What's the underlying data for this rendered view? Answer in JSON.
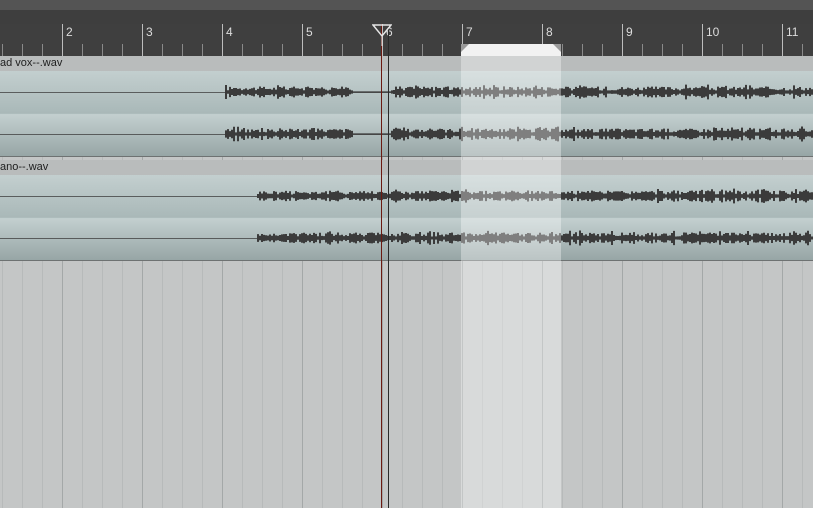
{
  "ruler": {
    "labels": [
      "2",
      "3",
      "4",
      "5",
      "6",
      "7",
      "8",
      "9",
      "10",
      "11"
    ]
  },
  "tracks": [
    {
      "item_name": "ad vox--.wav"
    },
    {
      "item_name": "ano--.wav"
    }
  ],
  "colors": {
    "ruler_bg": "#3f3f3f",
    "item_body": "#b3c2c2",
    "waveform": "#3b3b3b",
    "edit_cursor": "#6b1a12",
    "time_selection": "#e6eaea"
  },
  "icons": {
    "play_cursor": "triangle-down-icon",
    "selection_start": "triangle-left-icon",
    "selection_end": "triangle-right-icon"
  }
}
